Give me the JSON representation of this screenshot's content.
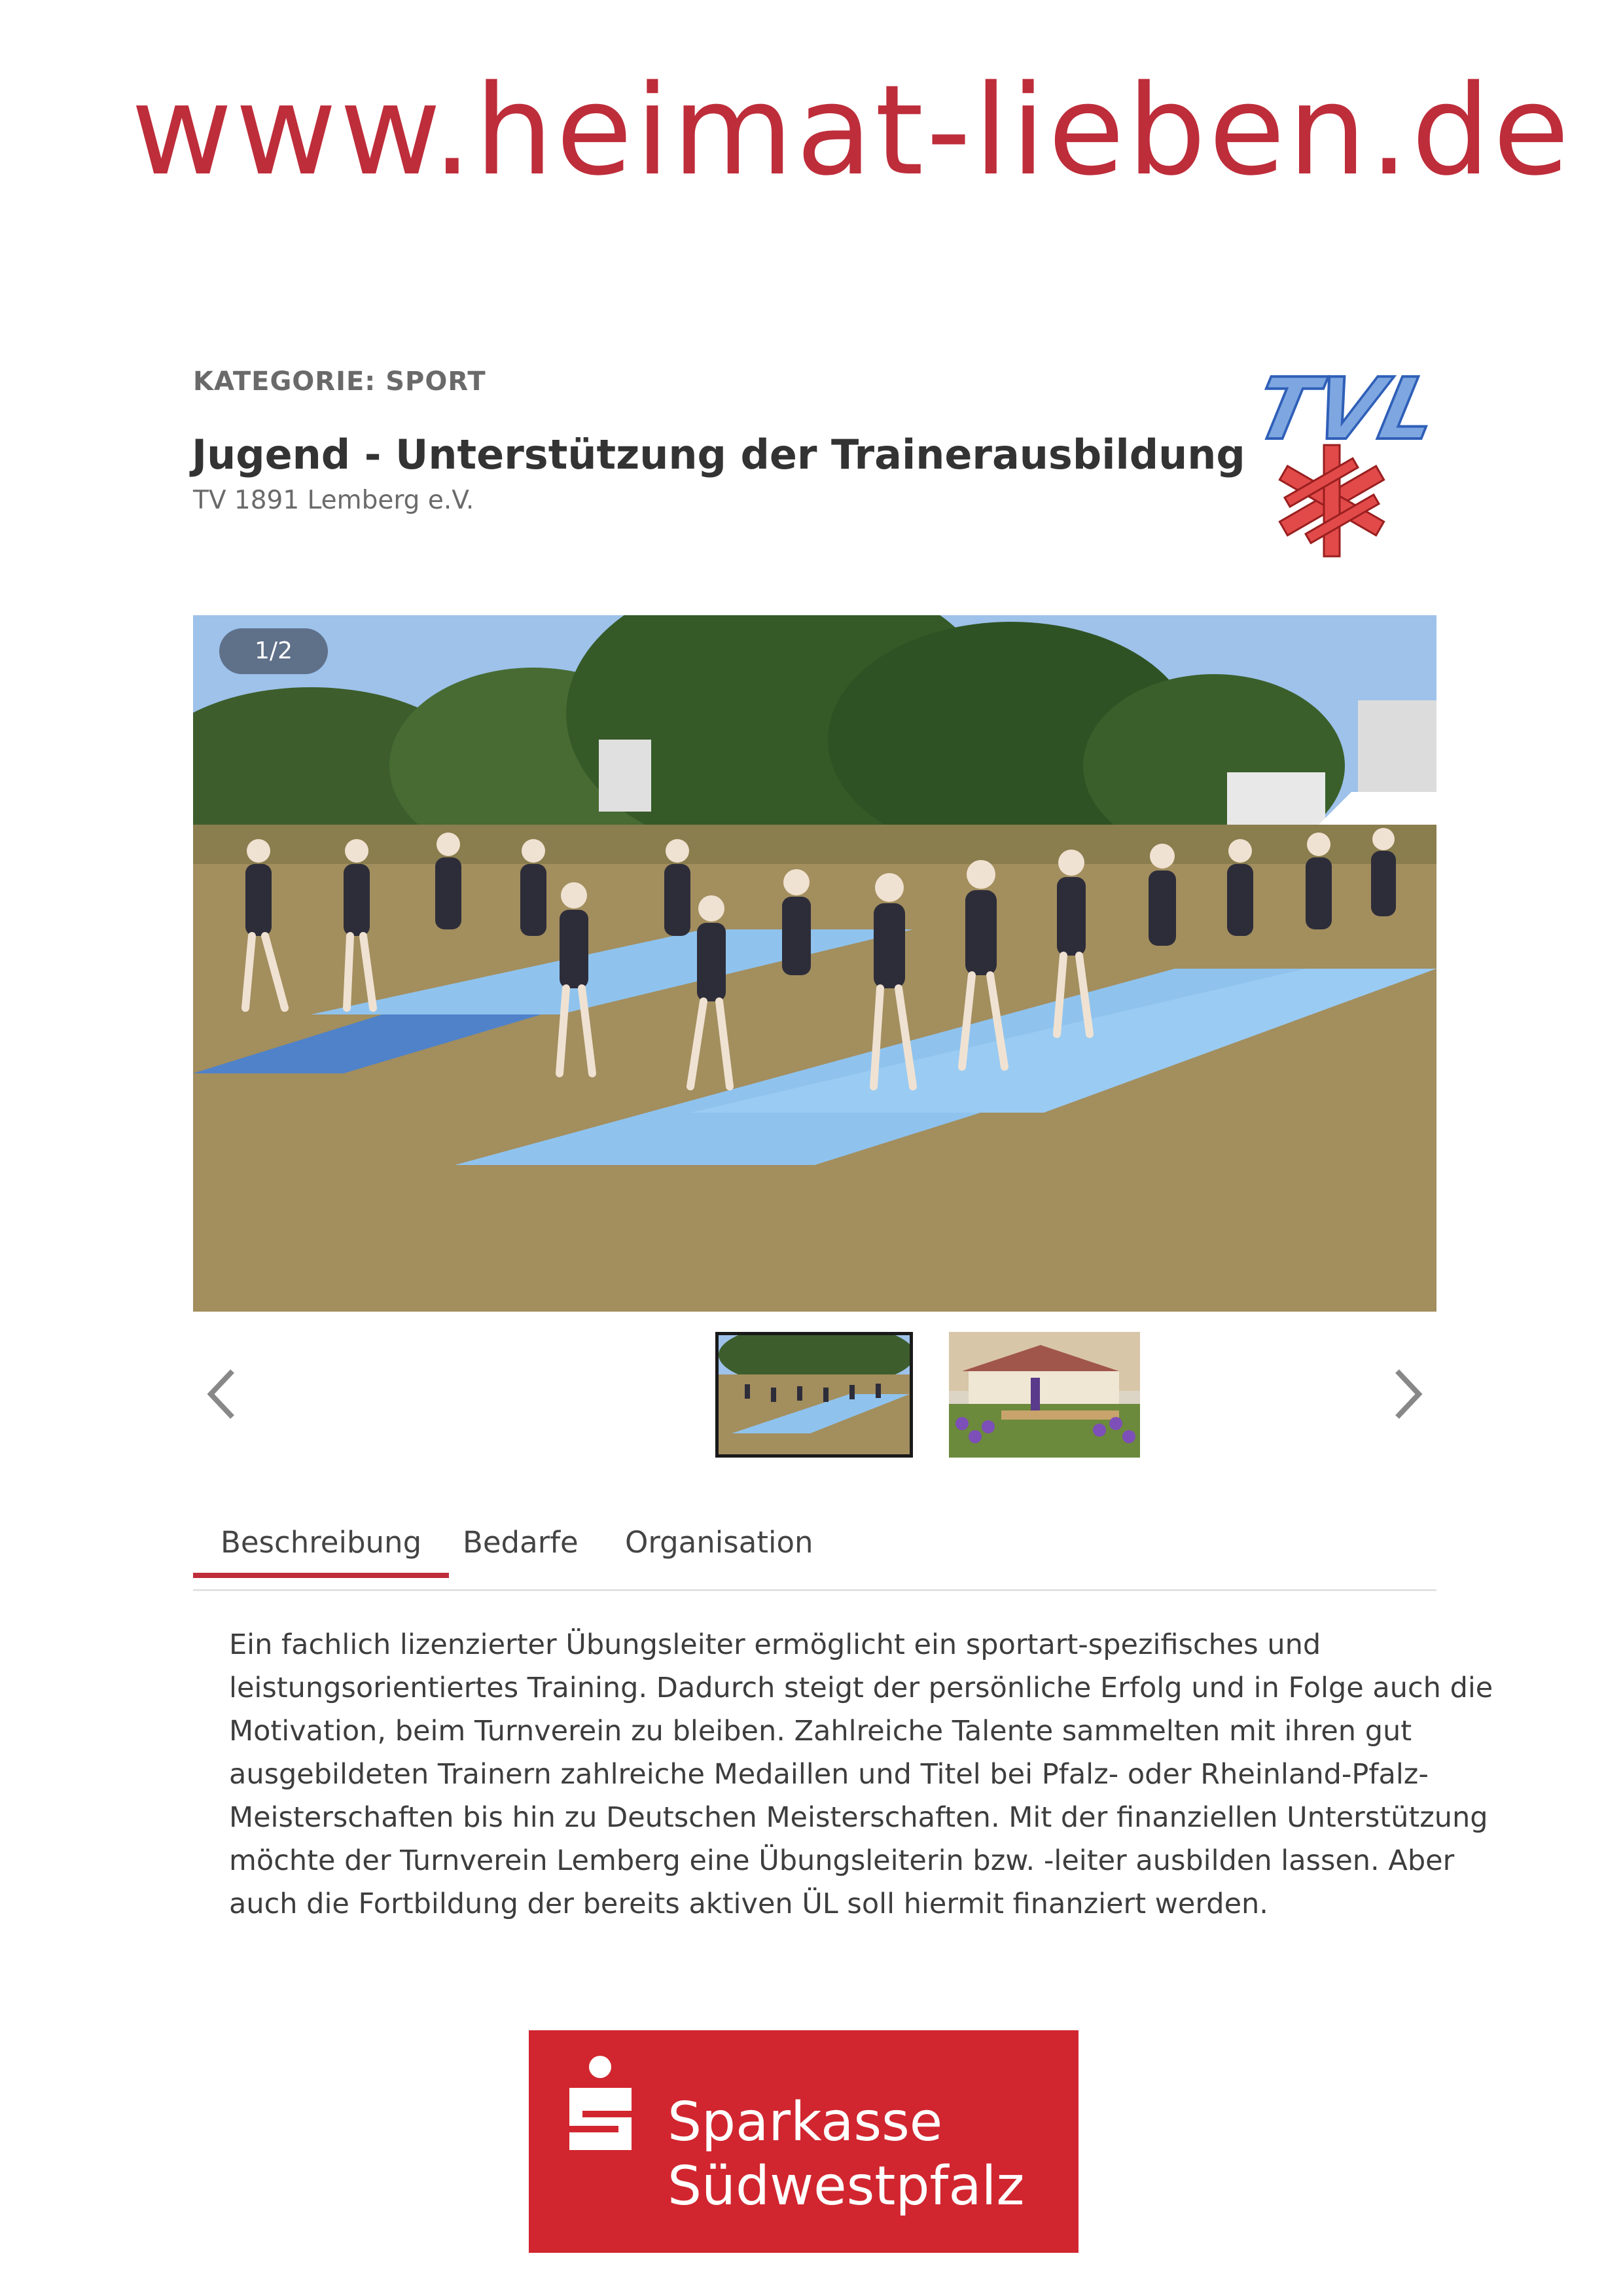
{
  "header": {
    "url": "www.heimat-lieben.de"
  },
  "project": {
    "category": "KATEGORIE: SPORT",
    "title": "Jugend - Unterstützung der Trainerausbildung",
    "organisation": "TV 1891 Lemberg e.V.",
    "logo_text": "TVL"
  },
  "gallery": {
    "counter": "1/2",
    "prev_icon": "chevron-left-icon",
    "next_icon": "chevron-right-icon",
    "thumbnails": 2,
    "selected_index": 0
  },
  "tabs": [
    {
      "label": "Beschreibung",
      "active": true
    },
    {
      "label": "Bedarfe",
      "active": false
    },
    {
      "label": "Organisation",
      "active": false
    }
  ],
  "description": [
    "Ein fachlich lizenzierter Übungsleiter ermöglicht ein sportart-spezifisches und",
    "leistungsorientiertes Training. Dadurch steigt der persönliche Erfolg und in Folge auch die",
    "Motivation, beim Turnverein zu bleiben. Zahlreiche Talente sammelten mit ihren gut",
    "ausgebildeten Trainern zahlreiche Medaillen und Titel bei Pfalz- oder Rheinland-Pfalz-",
    "Meisterschaften bis hin zu Deutschen Meisterschaften. Mit der finanziellen Unterstützung",
    "möchte der Turnverein Lemberg eine Übungsleiterin bzw. -leiter ausbilden lassen. Aber",
    "auch die Fortbildung der bereits aktiven ÜL soll hiermit finanziert werden."
  ],
  "sponsor": {
    "line1": "Sparkasse",
    "line2": "Südwestpfalz"
  },
  "colors": {
    "brand_red": "#be2d3a",
    "sparkasse_red": "#d1262f",
    "mat_blue": "#8fc3ee",
    "grass": "#a38e5e"
  }
}
